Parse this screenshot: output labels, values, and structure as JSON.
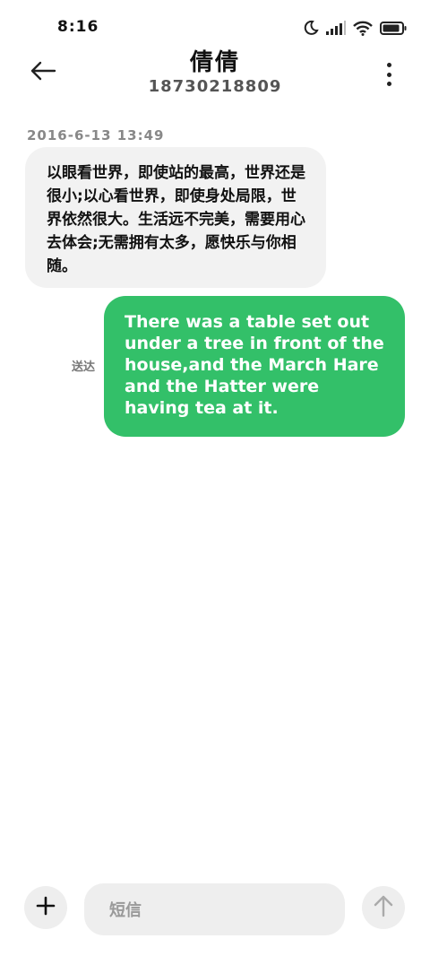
{
  "status_bar": {
    "time": "8:16",
    "battery_level": 0.9
  },
  "header": {
    "contact_name": "倩倩",
    "contact_number": "18730218809"
  },
  "conversation": {
    "timestamp": "2016-6-13 13:49",
    "incoming_message": "以眼看世界，即使站的最高，世界还是很小;以心看世界，即使身处局限，世界依然很大。生活远不完美，需要用心去体会;无需拥有太多，愿快乐与你相随。",
    "outgoing_message": "There was a table set out under a tree in front of the house,and the March Hare and the Hatter were having tea at it.",
    "outgoing_status": "送达"
  },
  "composer": {
    "placeholder": "短信"
  },
  "colors": {
    "outgoing_bubble": "#33c069",
    "incoming_bubble": "#f2f2f2",
    "background": "#ffffff"
  }
}
